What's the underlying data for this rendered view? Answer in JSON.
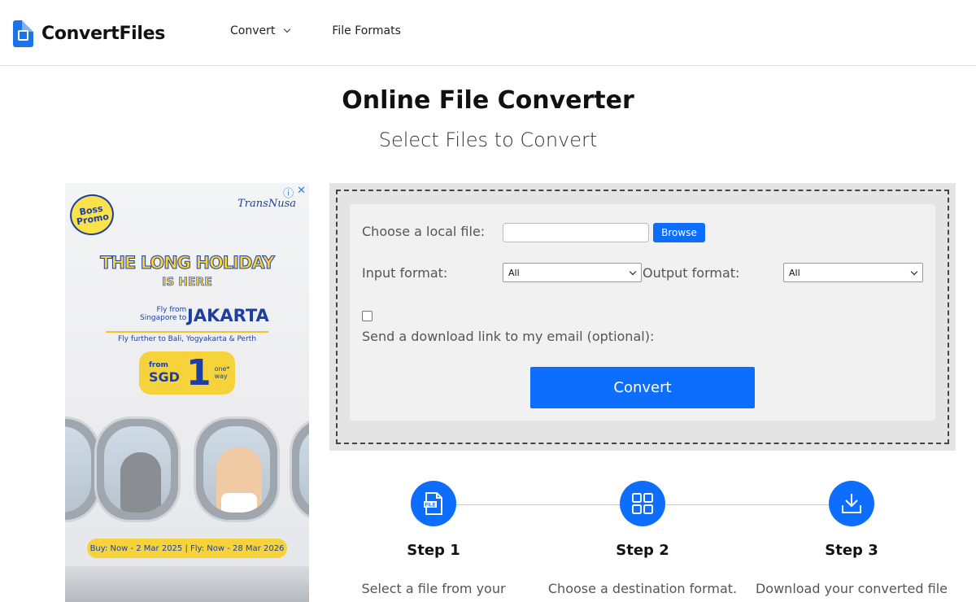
{
  "header": {
    "logo_text": "ConvertFiles",
    "nav": [
      {
        "label": "Convert",
        "has_dropdown": true
      },
      {
        "label": "File Formats",
        "has_dropdown": false
      }
    ]
  },
  "page": {
    "title": "Online File Converter",
    "subtitle": "Select Files to Convert"
  },
  "ad": {
    "badge": "Boss Promo",
    "brand": "TransNusa",
    "headline": "THE LONG HOLIDAY",
    "headline2": "IS HERE",
    "from_line1": "Fly from",
    "from_line2": "Singapore to",
    "city": "JAKARTA",
    "further": "Fly further to Bali, Yogyakarta & Perth",
    "price_from": "from",
    "price_currency": "SGD",
    "price_value": "1",
    "price_note": "one* way",
    "dates": "Buy: Now - 2 Mar 2025 | Fly: Now - 28 Mar 2026"
  },
  "form": {
    "local_file_label": "Choose a local file:",
    "file_value": "",
    "browse_label": "Browse",
    "input_format_label": "Input format:",
    "input_format_value": "All",
    "output_format_label": "Output format:",
    "output_format_value": "All",
    "email_checked": false,
    "email_label": "Send a download link to my email (optional):",
    "convert_label": "Convert"
  },
  "steps": [
    {
      "title": "Step 1",
      "desc": "Select a file from your",
      "icon": "file-icon"
    },
    {
      "title": "Step 2",
      "desc": "Choose a destination format.",
      "icon": "grid-icon"
    },
    {
      "title": "Step 3",
      "desc": "Download your converted file",
      "icon": "download-icon"
    }
  ],
  "colors": {
    "accent": "#0d6efd",
    "panel_bg": "#e4e4e4",
    "inner_bg": "#f1f1f1"
  }
}
